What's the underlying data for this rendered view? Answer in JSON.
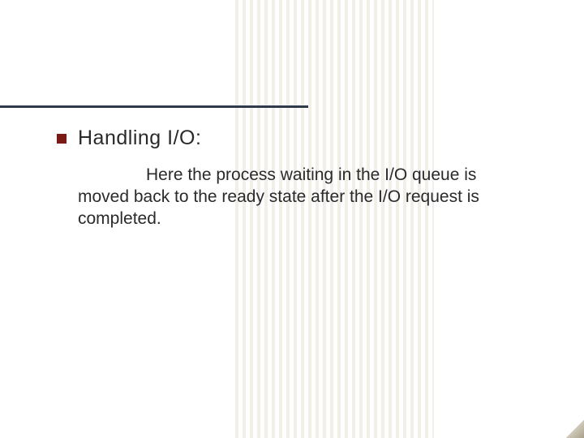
{
  "slide": {
    "heading": "Handling I/O:",
    "body": "Here the process waiting in the I/O queue is moved back to the ready state after the I/O request is completed.",
    "bullet_color": "#7a1a14",
    "rule_color": "#2f3a4a"
  }
}
